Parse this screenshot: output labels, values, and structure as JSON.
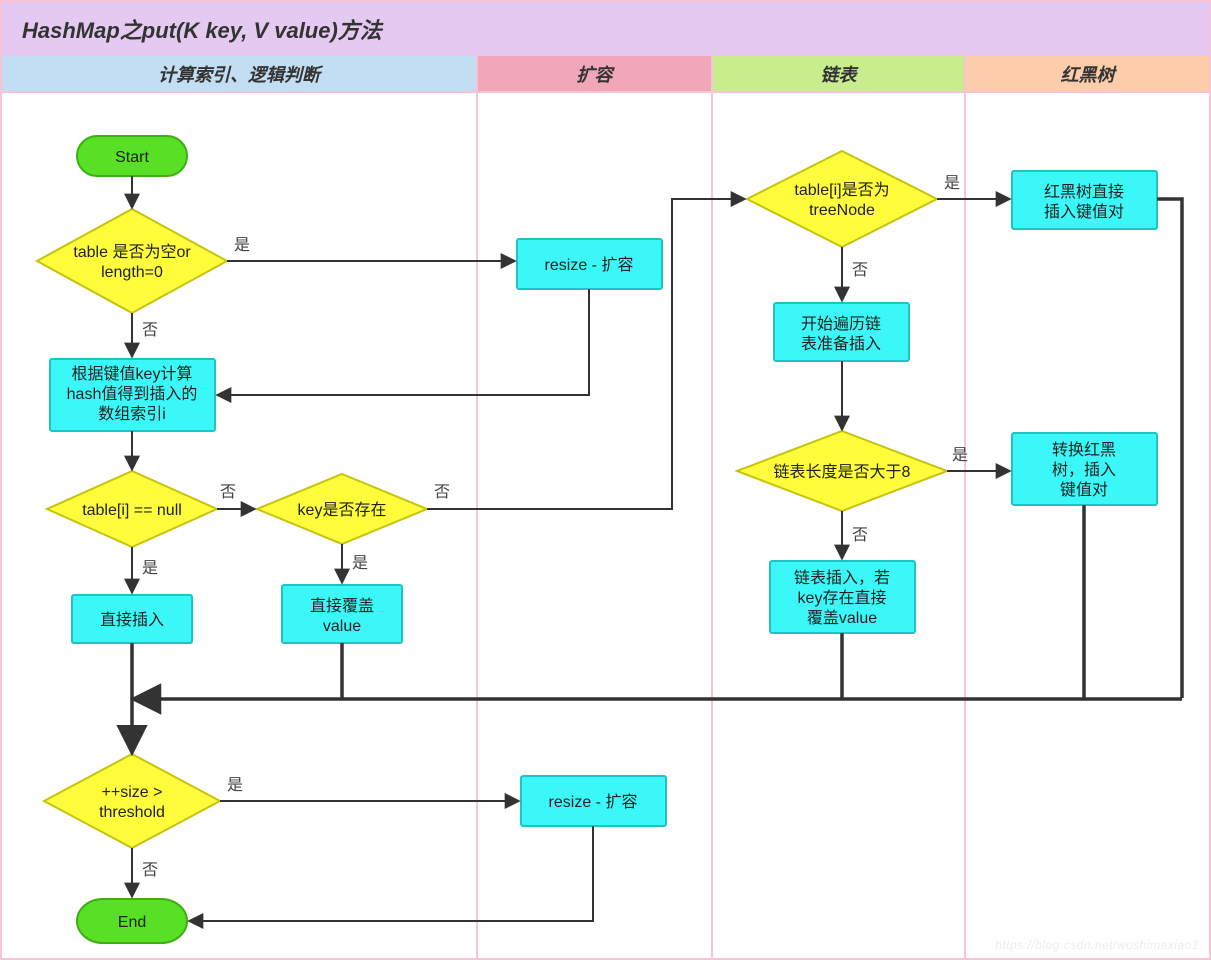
{
  "title": "HashMap之put(K key, V value)方法",
  "columns": [
    {
      "label": "计算索引、逻辑判断"
    },
    {
      "label": "扩容"
    },
    {
      "label": "链表"
    },
    {
      "label": "红黑树"
    }
  ],
  "nodes": {
    "start": "Start",
    "end": "End",
    "d_table_empty": [
      "table 是否为空or",
      "length=0"
    ],
    "p_resize1": "resize - 扩容",
    "p_compute_index": [
      "根据键值key计算",
      "hash值得到插入的",
      "数组索引i"
    ],
    "d_table_i_null": "table[i] == null",
    "d_key_exist": "key是否存在",
    "p_direct_insert": "直接插入",
    "p_override_value": [
      "直接覆盖",
      "value"
    ],
    "d_is_treenode": [
      "table[i]是否为",
      "treeNode"
    ],
    "p_rb_insert": [
      "红黑树直接",
      "插入键值对"
    ],
    "p_begin_traverse": [
      "开始遍历链",
      "表准备插入"
    ],
    "d_len_gt8": "链表长度是否大于8",
    "p_to_rb": [
      "转换红黑",
      "树，插入",
      "键值对"
    ],
    "p_list_insert": [
      "链表插入，若",
      "key存在直接",
      "覆盖value"
    ],
    "d_size_threshold": [
      "++size >",
      "threshold"
    ],
    "p_resize2": "resize - 扩容"
  },
  "edge_labels": {
    "yes": "是",
    "no": "否"
  },
  "watermark": "https://blog.csdn.net/woshimaxiao1"
}
